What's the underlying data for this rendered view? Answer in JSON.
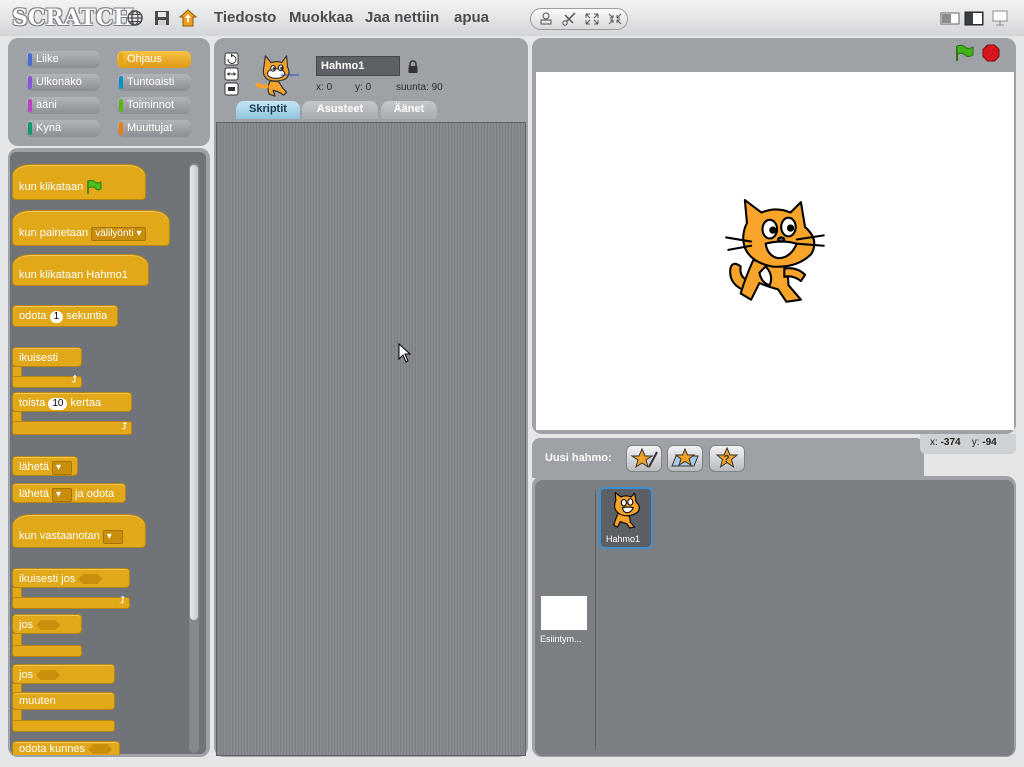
{
  "app": {
    "logo_text": "SCRATCH"
  },
  "toolbar": {
    "icons": [
      "globe-icon",
      "save-icon",
      "share-icon"
    ],
    "menus": [
      "Tiedosto",
      "Muokkaa",
      "Jaa nettiin",
      "apua"
    ],
    "mode_icons": [
      "stamp-icon",
      "scissors-icon",
      "grow-icon",
      "shrink-icon"
    ],
    "view_icons": [
      "small-stage-icon",
      "normal-stage-icon",
      "presentation-mode-icon"
    ]
  },
  "categories": [
    {
      "label": "Liike",
      "color": "#4a6cd4"
    },
    {
      "label": "Ohjaus",
      "color": "#e1a91a",
      "active": true
    },
    {
      "label": "Ulkonäkö",
      "color": "#8a55d7"
    },
    {
      "label": "Tuntoaisti",
      "color": "#0c93c4"
    },
    {
      "label": "ääni",
      "color": "#bb42c3"
    },
    {
      "label": "Toiminnot",
      "color": "#5cb712"
    },
    {
      "label": "Kynä",
      "color": "#0e9a6c"
    },
    {
      "label": "Muuttujat",
      "color": "#ee7d16"
    }
  ],
  "palette": {
    "when_flag": "kun klikataan",
    "when_key": "kun painetaan",
    "when_key_value": "välilyönti",
    "when_clicked": "kun klikataan Hahmo1",
    "wait_pre": "odota",
    "wait_value": "1",
    "wait_post": "sekuntia",
    "forever": "ikuisesti",
    "repeat_pre": "toista",
    "repeat_value": "10",
    "repeat_post": "kertaa",
    "broadcast": "lähetä",
    "broadcast_wait_pre": "lähetä",
    "broadcast_wait_post": "ja odota",
    "when_receive": "kun vastaanotan",
    "forever_if": "ikuisesti jos",
    "if": "jos",
    "if_else_if": "jos",
    "if_else_else": "muuten",
    "wait_until": "odota kunnes"
  },
  "sprite": {
    "name": "Hahmo1",
    "x_label": "x:",
    "x_value": "0",
    "y_label": "y:",
    "y_value": "0",
    "direction_label": "suunta:",
    "direction_value": "90"
  },
  "tabs": [
    "Skriptit",
    "Asusteet",
    "Äänet"
  ],
  "active_tab": "Skriptit",
  "stage_controls": [
    "green-flag-icon",
    "stop-icon"
  ],
  "new_sprite": {
    "label": "Uusi hahmo:",
    "buttons": [
      "paint-sprite-icon",
      "choose-sprite-icon",
      "random-sprite-icon"
    ]
  },
  "mouse": {
    "x_label": "x:",
    "x_value": "-374",
    "y_label": "y:",
    "y_value": "-94"
  },
  "sprite_list": {
    "sprites": [
      "Hahmo1"
    ],
    "stage_label": "Esiintym..."
  }
}
